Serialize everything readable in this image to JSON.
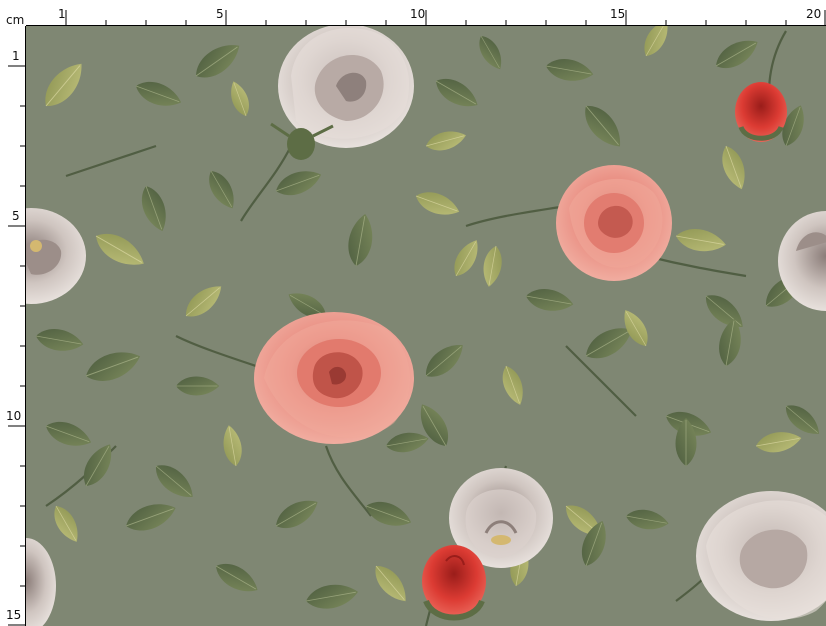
{
  "ruler": {
    "unit_label": "cm",
    "top_labels": [
      "1",
      "5",
      "10",
      "15",
      "20"
    ],
    "left_labels": [
      "1",
      "5",
      "10",
      "15"
    ]
  },
  "fabric": {
    "background_color": "#7f8773",
    "leaf_color": "#5f6e50",
    "leaf_light_color": "#a8ad6e",
    "rose_pink_color": "#e0776c",
    "rose_red_color": "#d53a32",
    "rose_white_color": "#d6cdc7"
  }
}
